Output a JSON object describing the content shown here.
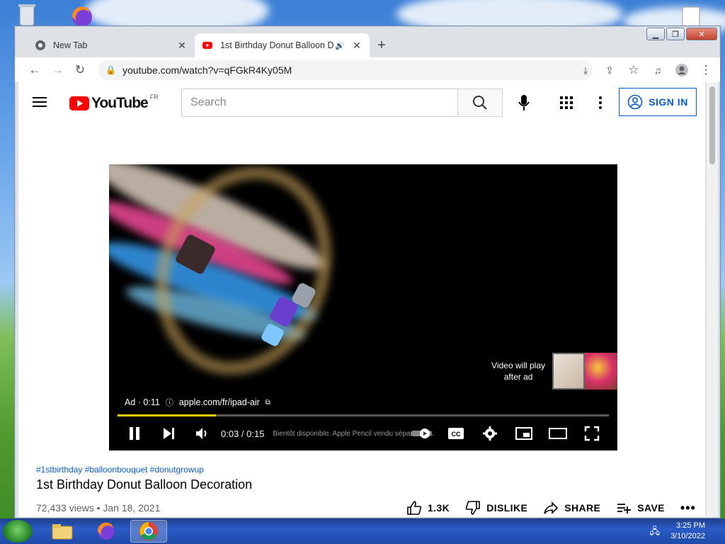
{
  "desktop": {
    "icons": [
      "recycle-bin-icon",
      "firefox-icon",
      "document-icon"
    ]
  },
  "browser": {
    "tabs": [
      {
        "title": "New Tab",
        "favicon": "chrome-icon"
      },
      {
        "title": "1st Birthday Donut Balloon D",
        "favicon": "youtube-icon",
        "audio": true
      }
    ],
    "url": "youtube.com/watch?v=qFGkR4Ky05M",
    "window_controls": [
      "minimize",
      "maximize",
      "close"
    ]
  },
  "youtube": {
    "logo_text": "YouTube",
    "region": "FR",
    "search_placeholder": "Search",
    "sign_in_label": "SIGN IN",
    "brand_red": "#ff0000",
    "link_blue": "#065fd4"
  },
  "player": {
    "ad_label": "Ad · 0:11",
    "ad_link": "apple.com/fr/ipad-air",
    "next_text_1": "Video will play",
    "next_text_2": "after ad",
    "time": "0:03 / 0:15",
    "ad_caption": "Bientôt disponible. Apple Pencil vendu séparément.",
    "progress": 0.2,
    "progress_color": "#ffcc00"
  },
  "video": {
    "hashtags": "#1stbirthday #balloonbouquet #donutgrowup",
    "title": "1st Birthday Donut Balloon Decoration",
    "info": "72,433 views • Jan 18, 2021",
    "likes": "1.3K",
    "dislike_label": "DISLIKE",
    "share_label": "SHARE",
    "save_label": "SAVE"
  },
  "taskbar": {
    "time": "3:25 PM",
    "date": "3/10/2022"
  }
}
